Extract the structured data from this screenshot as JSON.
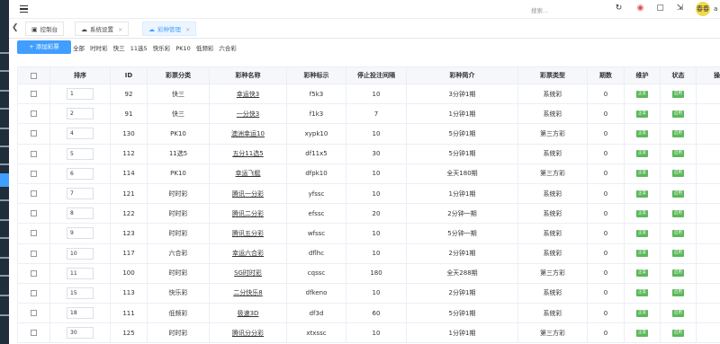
{
  "header": {
    "search_label": "搜索...",
    "avatar_text": "春春",
    "user_initial": "a"
  },
  "tabs": [
    {
      "label": "控制台",
      "icon": "monitor-icon"
    },
    {
      "label": "系统设置",
      "icon": "cloud-icon"
    },
    {
      "label": "彩种管理",
      "icon": "cloud-icon"
    }
  ],
  "toolbar": {
    "add_label": "+ 添加彩票",
    "filters": [
      "全部",
      "时时彩",
      "快三",
      "11选5",
      "快乐彩",
      "PK10",
      "低频彩",
      "六合彩"
    ]
  },
  "table": {
    "headers": [
      "",
      "排序",
      "ID",
      "彩票分类",
      "彩种名称",
      "彩种标示",
      "停止投注间隔",
      "彩种简介",
      "彩票类型",
      "期数",
      "维护",
      "状态",
      "操"
    ],
    "maint_label": "正常",
    "status_label": "启用",
    "rows": [
      {
        "sort": "1",
        "id": "92",
        "cat": "快三",
        "name": "幸运快3",
        "code": "f5k3",
        "stop": "10",
        "intro": "3分钟1期",
        "type": "系统彩",
        "periods": "0"
      },
      {
        "sort": "2",
        "id": "91",
        "cat": "快三",
        "name": "一分快3",
        "code": "f1k3",
        "stop": "7",
        "intro": "1分钟1期",
        "type": "系统彩",
        "periods": "0"
      },
      {
        "sort": "4",
        "id": "130",
        "cat": "PK10",
        "name": "澳洲幸运10",
        "code": "xypk10",
        "stop": "10",
        "intro": "5分钟1期",
        "type": "第三方彩",
        "periods": "0"
      },
      {
        "sort": "5",
        "id": "112",
        "cat": "11选5",
        "name": "五分11选5",
        "code": "df11x5",
        "stop": "30",
        "intro": "5分钟1期",
        "type": "系统彩",
        "periods": "0"
      },
      {
        "sort": "6",
        "id": "114",
        "cat": "PK10",
        "name": "幸运飞艇",
        "code": "dfpk10",
        "stop": "10",
        "intro": "全天180期",
        "type": "第三方彩",
        "periods": "0"
      },
      {
        "sort": "7",
        "id": "121",
        "cat": "时时彩",
        "name": "腾讯一分彩",
        "code": "yfssc",
        "stop": "10",
        "intro": "1分钟1期",
        "type": "系统彩",
        "periods": "0"
      },
      {
        "sort": "8",
        "id": "122",
        "cat": "时时彩",
        "name": "腾讯二分彩",
        "code": "efssc",
        "stop": "20",
        "intro": "2分钟一期",
        "type": "系统彩",
        "periods": "0"
      },
      {
        "sort": "9",
        "id": "123",
        "cat": "时时彩",
        "name": "腾讯五分彩",
        "code": "wfssc",
        "stop": "10",
        "intro": "5分钟一期",
        "type": "系统彩",
        "periods": "0"
      },
      {
        "sort": "10",
        "id": "117",
        "cat": "六合彩",
        "name": "幸运六合彩",
        "code": "dflhc",
        "stop": "10",
        "intro": "2分钟1期",
        "type": "系统彩",
        "periods": "0"
      },
      {
        "sort": "11",
        "id": "100",
        "cat": "时时彩",
        "name": "SG时时彩",
        "code": "cqssc",
        "stop": "180",
        "intro": "全天288期",
        "type": "第三方彩",
        "periods": "0"
      },
      {
        "sort": "15",
        "id": "113",
        "cat": "快乐彩",
        "name": "二分快乐8",
        "code": "dfkeno",
        "stop": "10",
        "intro": "2分钟1期",
        "type": "系统彩",
        "periods": "0"
      },
      {
        "sort": "18",
        "id": "111",
        "cat": "低频彩",
        "name": "极速3D",
        "code": "df3d",
        "stop": "60",
        "intro": "5分钟1期",
        "type": "系统彩",
        "periods": "0"
      },
      {
        "sort": "30",
        "id": "125",
        "cat": "时时彩",
        "name": "腾讯分分彩",
        "code": "xtxssc",
        "stop": "10",
        "intro": "1分钟1期",
        "type": "第三方彩",
        "periods": "0"
      }
    ]
  }
}
